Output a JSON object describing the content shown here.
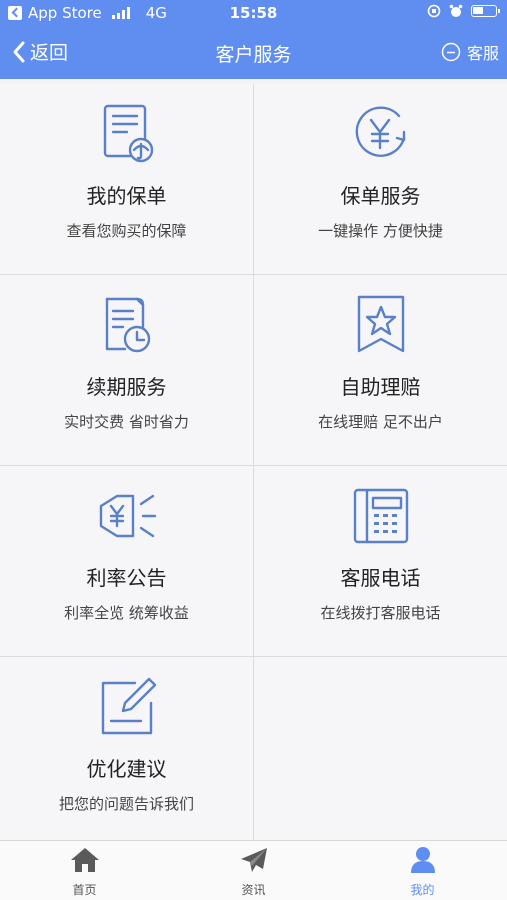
{
  "status_bar": {
    "carrier": "App Store",
    "network": "4G",
    "time": "15:58"
  },
  "nav": {
    "back_label": "返回",
    "title": "客户服务",
    "service_label": "客服"
  },
  "grid": {
    "items": [
      {
        "title": "我的保单",
        "subtitle": "查看您购买的保障",
        "icon": "policy-document-icon"
      },
      {
        "title": "保单服务",
        "subtitle": "一键操作 方便快捷",
        "icon": "yuan-refresh-icon"
      },
      {
        "title": "续期服务",
        "subtitle": "实时交费 省时省力",
        "icon": "renewal-clock-icon"
      },
      {
        "title": "自助理赔",
        "subtitle": "在线理赔 足不出户",
        "icon": "star-bookmark-icon"
      },
      {
        "title": "利率公告",
        "subtitle": "利率全览 统筹收益",
        "icon": "megaphone-yuan-icon"
      },
      {
        "title": "客服电话",
        "subtitle": "在线拨打客服电话",
        "icon": "telephone-icon"
      },
      {
        "title": "优化建议",
        "subtitle": "把您的问题告诉我们",
        "icon": "edit-note-icon"
      }
    ]
  },
  "tabs": [
    {
      "label": "首页",
      "icon": "home-icon",
      "active": false
    },
    {
      "label": "资讯",
      "icon": "paper-plane-icon",
      "active": false
    },
    {
      "label": "我的",
      "icon": "user-icon",
      "active": true
    }
  ],
  "colors": {
    "header": "#5f8ef0",
    "icon_stroke": "#5a80c8",
    "active_tab": "#5f8ef0"
  }
}
